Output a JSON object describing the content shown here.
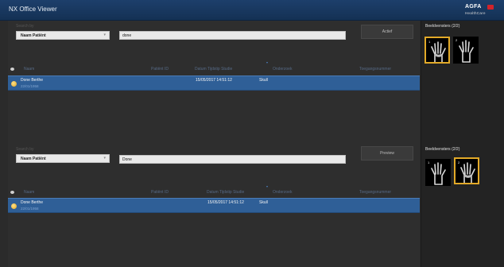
{
  "app": {
    "title": "NX Office Viewer",
    "logo": {
      "brand": "AGFA",
      "sub": "HealthCare"
    }
  },
  "panels": [
    {
      "search_label": "Search by",
      "field_select": "Naam Patiënt",
      "search_value": "done",
      "action_label": "Actief",
      "columns": [
        "Naam",
        "Patiënt ID",
        "Datum Tijdstip Studie",
        "Onderzoek",
        "Toegangsnummer"
      ],
      "rows": [
        {
          "name": "Done Berthe",
          "dob": "22/01/1958",
          "datetime": "15/05/2017 14:51:12",
          "exam": "Skull"
        }
      ]
    },
    {
      "search_label": "Search by",
      "field_select": "Naam Patiënt",
      "search_value": "Done",
      "action_label": "Preview",
      "columns": [
        "Naam",
        "Patiënt ID",
        "Datum Tijdstip Studie",
        "Onderzoek",
        "Toegangsnummer"
      ],
      "rows": [
        {
          "name": "Done Berthe",
          "dob": "22/01/1958",
          "datetime": "15/05/2017 14:51:12",
          "exam": "Skull"
        }
      ]
    }
  ],
  "viewers": [
    {
      "title": "Beeldvensters (2/2)",
      "thumbnails": [
        {
          "index": "1",
          "selected": true,
          "kind": "hand"
        },
        {
          "index": "2",
          "selected": false,
          "kind": "hand"
        }
      ]
    },
    {
      "title": "Beeldvensters (2/2)",
      "thumbnails": [
        {
          "index": "1",
          "selected": false,
          "kind": "hand"
        },
        {
          "index": "2",
          "selected": true,
          "kind": "hand"
        }
      ]
    }
  ],
  "colors": {
    "title_bar": "#143154",
    "selected_row": "#2f5f97",
    "selected_thumb": "#e2a928",
    "logo_red": "#d2232a"
  },
  "icons": [
    "eye-icon",
    "patient-icon",
    "chevron-down-icon"
  ]
}
